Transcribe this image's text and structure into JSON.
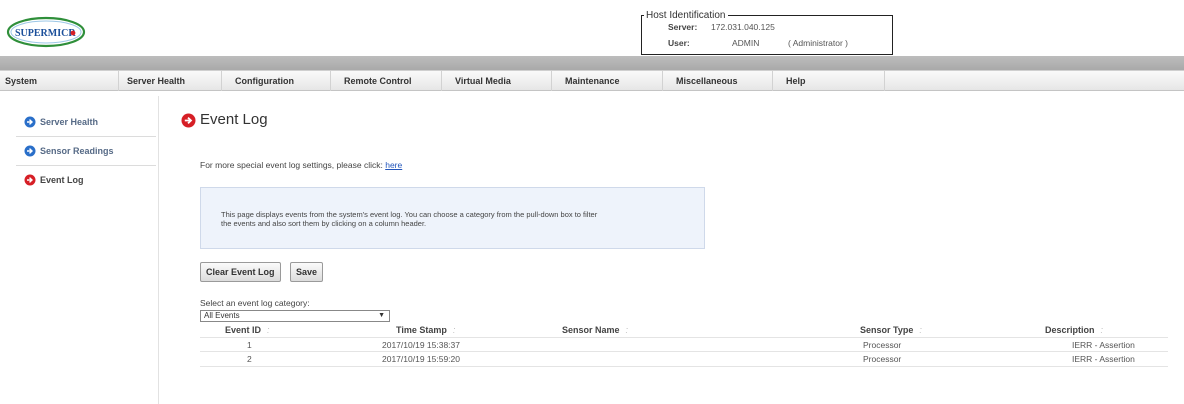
{
  "brand": {
    "logo_text": "SUPERMICR",
    "accent": "#d61f26",
    "logo_blue": "#1b4f9a"
  },
  "host": {
    "legend": "Host Identification",
    "server_label": "Server:",
    "server_value": "172.031.040.125",
    "user_label": "User:",
    "user_value": "ADMIN",
    "user_role": "( Administrator )"
  },
  "menu": [
    "System",
    "Server Health",
    "Configuration",
    "Remote Control",
    "Virtual Media",
    "Maintenance",
    "Miscellaneous",
    "Help"
  ],
  "sidebar": {
    "items": [
      {
        "label": "Server Health",
        "icon": "arrow-circle-blue-icon"
      },
      {
        "label": "Sensor Readings",
        "icon": "arrow-circle-blue-icon"
      },
      {
        "label": "Event Log",
        "icon": "arrow-circle-red-icon"
      }
    ]
  },
  "main": {
    "title": "Event Log",
    "settings_text": "For more special event log settings, please click:",
    "settings_link": "here",
    "info_line1": "This page displays events from the system's event log. You can choose a category from the pull-down box to filter",
    "info_line2": "the events and also sort them by clicking on a column header.",
    "clear_button": "Clear Event Log",
    "save_button": "Save",
    "select_label": "Select an event log category:",
    "select_value": "All Events"
  },
  "table": {
    "columns": [
      "Event ID",
      "Time Stamp",
      "Sensor Name",
      "Sensor Type",
      "Description"
    ],
    "sort_glyph": ":",
    "rows": [
      [
        "1",
        "2017/10/19 15:38:37",
        "",
        "Processor",
        "IERR - Assertion"
      ],
      [
        "2",
        "2017/10/19 15:59:20",
        "",
        "Processor",
        "IERR - Assertion"
      ]
    ]
  }
}
